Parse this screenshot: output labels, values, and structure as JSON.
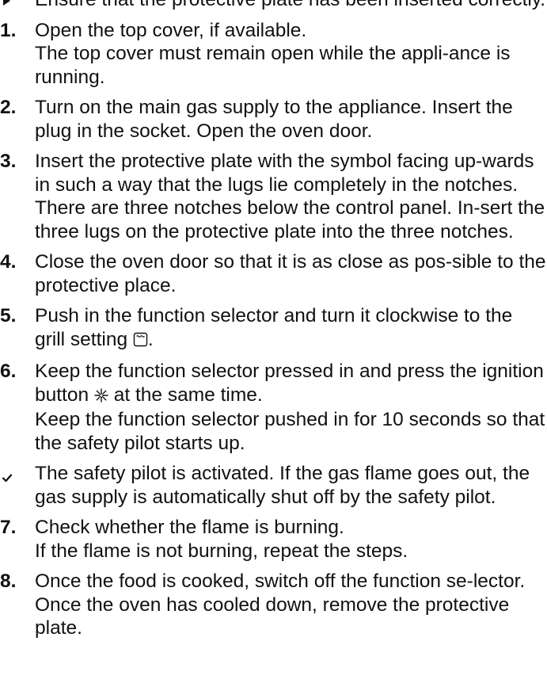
{
  "precondition": {
    "text": "Ensure that the protective plate has been inserted correctly."
  },
  "steps": [
    {
      "num": "1.",
      "lines": [
        "Open the top cover, if available.",
        "The top cover must remain open while the appli-ance is running."
      ]
    },
    {
      "num": "2.",
      "lines": [
        "Turn on the main gas supply to the appliance. Insert the plug in the socket. Open the oven door."
      ]
    },
    {
      "num": "3.",
      "lines": [
        "Insert the protective plate with the symbol facing up-wards in such a way that the lugs lie completely in the notches.",
        "There are three notches below the control panel. In-sert the three lugs on the protective plate into the three notches."
      ]
    },
    {
      "num": "4.",
      "lines": [
        "Close the oven door so that it is as close as pos-sible to the protective place."
      ]
    },
    {
      "num": "5.",
      "before": "Push in the function selector and turn it clockwise to the grill setting ",
      "after": "."
    },
    {
      "num": "6.",
      "before": "Keep the function selector pressed in and press the ignition button ",
      "after": " at the same time.",
      "extra": "Keep the function selector pushed in for 10 seconds so that the safety pilot starts up."
    }
  ],
  "result": {
    "text": "The safety pilot is activated. If the gas flame goes out, the gas supply is automatically shut off by the safety pilot."
  },
  "steps_after": [
    {
      "num": "7.",
      "lines": [
        "Check whether the flame is burning.",
        "If the flame is not burning, repeat the steps."
      ]
    },
    {
      "num": "8.",
      "lines": [
        "Once the food is cooked, switch off the function se-lector. Once the oven has cooled down, remove the protective plate."
      ]
    }
  ],
  "icons": {
    "precondition": "triangle-bullet-icon",
    "result": "checkmark-icon",
    "grill": "grill-symbol-icon",
    "ignition": "ignition-spark-icon"
  }
}
